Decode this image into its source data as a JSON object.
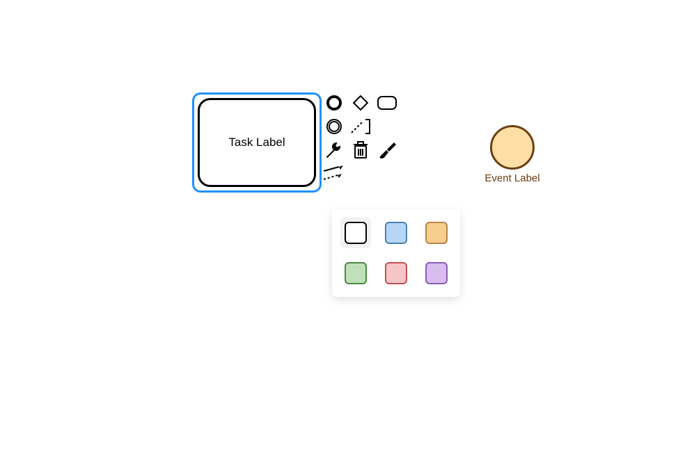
{
  "nodes": {
    "task": {
      "label": "Task Label",
      "selected": true
    },
    "event": {
      "label": "Event Label",
      "fill": "#ffdfa6",
      "stroke": "#6b3f11"
    }
  },
  "context_pad": {
    "items": [
      {
        "name": "append-end-event",
        "icon": "circle-thick"
      },
      {
        "name": "append-gateway",
        "icon": "diamond"
      },
      {
        "name": "append-task",
        "icon": "rounded-rect"
      },
      {
        "name": "append-intermediate-event",
        "icon": "double-circle"
      },
      {
        "name": "connect-association",
        "icon": "dashed-bracket"
      },
      {
        "name": "change-type",
        "icon": "wrench"
      },
      {
        "name": "delete",
        "icon": "trash"
      },
      {
        "name": "set-color",
        "icon": "paint-brush"
      },
      {
        "name": "connect",
        "icon": "arrows"
      }
    ]
  },
  "color_picker": {
    "selected_index": 0,
    "swatches": [
      {
        "name": "white",
        "fill": "#ffffff",
        "border": "#000000"
      },
      {
        "name": "blue",
        "fill": "#b7d6f5",
        "border": "#4a80b5"
      },
      {
        "name": "orange",
        "fill": "#f7ce8f",
        "border": "#b58443"
      },
      {
        "name": "green",
        "fill": "#bfe0b9",
        "border": "#4a8a42"
      },
      {
        "name": "red",
        "fill": "#f4c6c6",
        "border": "#c05050"
      },
      {
        "name": "purple",
        "fill": "#d8bdee",
        "border": "#8a5db5"
      }
    ]
  }
}
